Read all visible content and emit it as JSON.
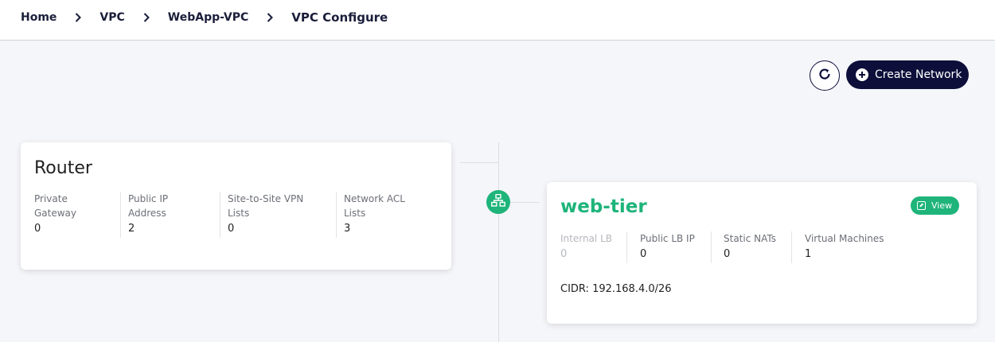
{
  "breadcrumb": {
    "items": [
      "Home",
      "VPC",
      "WebApp-VPC"
    ],
    "current": "VPC Configure"
  },
  "toolbar": {
    "create_label": "Create Network"
  },
  "router": {
    "title": "Router",
    "stats": [
      {
        "label": "Private Gateway",
        "value": "0"
      },
      {
        "label": "Public IP Address",
        "value": "2"
      },
      {
        "label": "Site-to-Site VPN Lists",
        "value": "0"
      },
      {
        "label": "Network ACL Lists",
        "value": "3"
      }
    ]
  },
  "tier": {
    "title": "web-tier",
    "view_label": "View",
    "stats": [
      {
        "label": "Internal LB",
        "value": "0",
        "disabled": true
      },
      {
        "label": "Public LB IP",
        "value": "0"
      },
      {
        "label": "Static NATs",
        "value": "0"
      },
      {
        "label": "Virtual Machines",
        "value": "1"
      }
    ],
    "cidr": "CIDR: 192.168.4.0/26"
  },
  "colors": {
    "navy": "#0d0f3a",
    "green": "#1eb47a",
    "background": "#f5f6fa"
  },
  "icons": [
    "chevron-right-icon",
    "refresh-icon",
    "plus-circle-icon",
    "network-icon",
    "external-link-icon"
  ]
}
